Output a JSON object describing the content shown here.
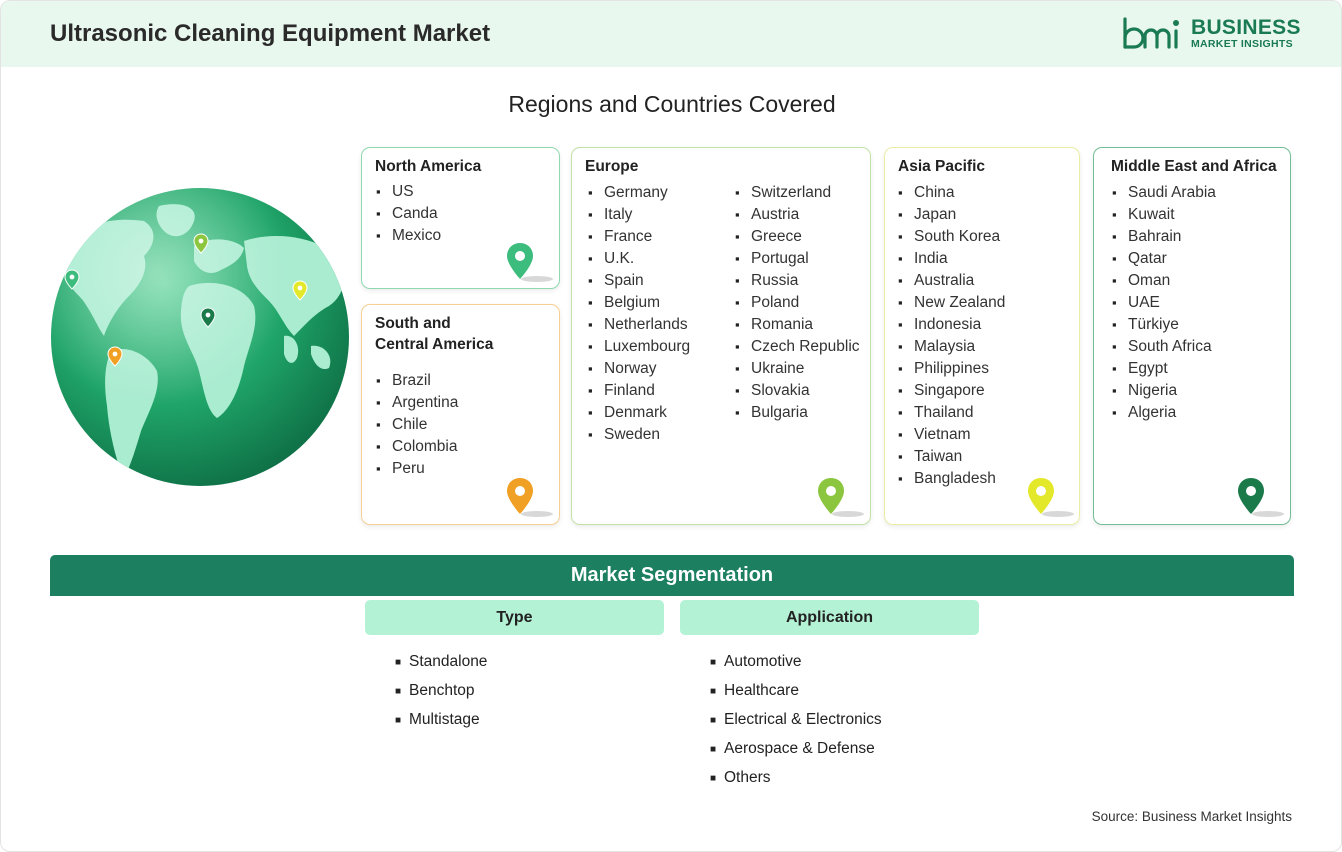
{
  "header": {
    "title": "Ultrasonic Cleaning Equipment Market",
    "logo_line1": "BUSINESS",
    "logo_line2": "MARKET INSIGHTS"
  },
  "regions_title": "Regions and Countries Covered",
  "regions": {
    "north_america": {
      "title": "North America",
      "items": [
        "US",
        "Canda",
        "Mexico"
      ],
      "pin_color": "#3dbd7d"
    },
    "south_central_america": {
      "title_line1": "South and",
      "title_line2": "Central America",
      "items": [
        "Brazil",
        "Argentina",
        "Chile",
        "Colombia",
        "Peru"
      ],
      "pin_color": "#f0a024"
    },
    "europe": {
      "title": "Europe",
      "col1": [
        "Germany",
        "Italy",
        "France",
        "U.K.",
        "Spain",
        "Belgium",
        "Netherlands",
        "Luxembourg",
        "Norway",
        "Finland",
        "Denmark",
        "Sweden"
      ],
      "col2": [
        "Switzerland",
        "Austria",
        "Greece",
        "Portugal",
        "Russia",
        "Poland",
        "Romania",
        "Czech Republic",
        "Ukraine",
        "Slovakia",
        "Bulgaria"
      ],
      "pin_color": "#8cc63f"
    },
    "asia_pacific": {
      "title": "Asia Pacific",
      "items": [
        "China",
        "Japan",
        "South Korea",
        "India",
        "Australia",
        "New Zealand",
        "Indonesia",
        "Malaysia",
        "Philippines",
        "Singapore",
        "Thailand",
        "Vietnam",
        "Taiwan",
        "Bangladesh"
      ],
      "pin_color": "#e4e82a"
    },
    "middle_east_africa": {
      "title": "Middle East and Africa",
      "items": [
        "Saudi Arabia",
        "Kuwait",
        "Bahrain",
        "Qatar",
        "Oman",
        "UAE",
        "Türkiye",
        "South Africa",
        "Egypt",
        "Nigeria",
        "Algeria"
      ],
      "pin_color": "#1b7a4a"
    }
  },
  "segmentation": {
    "title": "Market Segmentation",
    "type": {
      "label": "Type",
      "items": [
        "Standalone",
        "Benchtop",
        "Multistage"
      ]
    },
    "application": {
      "label": "Application",
      "items": [
        "Automotive",
        "Healthcare",
        "Electrical & Electronics",
        "Aerospace & Defense",
        "Others"
      ]
    }
  },
  "source": "Source: Business Market Insights",
  "colors": {
    "brand": "#1a7a52",
    "header_bg": "#e9f8ef",
    "segment_bar": "#1c8060",
    "segment_head": "#b3f2d5"
  },
  "icons": [
    "globe-icon",
    "location-pin-icon",
    "bmi-logo-icon"
  ]
}
